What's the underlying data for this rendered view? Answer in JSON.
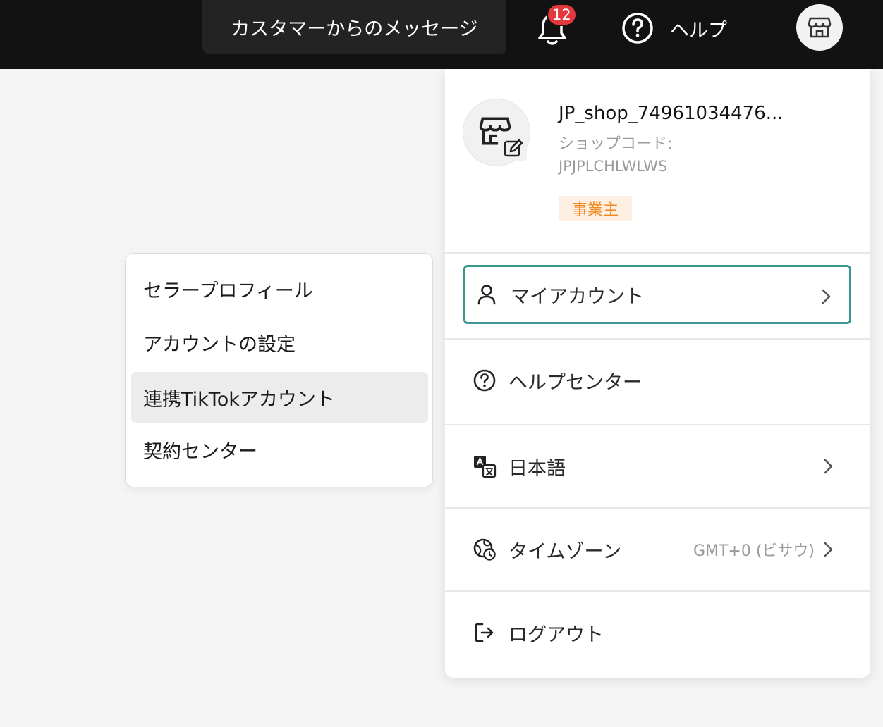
{
  "header": {
    "customer_messages_label": "カスタマーからのメッセージ",
    "notification_count": "12",
    "help_label": "ヘルプ"
  },
  "account_panel": {
    "shop_name": "JP_shop_74961034476...",
    "shop_code_label": "ショップコード:",
    "shop_code": "JPJPLCHLWLWS",
    "owner_badge": "事業主",
    "items": [
      {
        "label": "マイアカウント",
        "icon": "user-icon",
        "selected": true
      },
      {
        "label": "ヘルプセンター",
        "icon": "question-circle-icon"
      },
      {
        "label": "日本語",
        "icon": "translate-icon"
      },
      {
        "label": "タイムゾーン",
        "icon": "globe-clock-icon",
        "value": "GMT+0 (ビサウ)"
      },
      {
        "label": "ログアウト",
        "icon": "logout-icon"
      }
    ]
  },
  "submenu": {
    "items": [
      {
        "label": "セラープロフィール"
      },
      {
        "label": "アカウントの設定"
      },
      {
        "label": "連携TikTokアカウント",
        "active": true
      },
      {
        "label": "契約センター"
      }
    ]
  },
  "colors": {
    "topbar": "#121212",
    "badge_red": "#e4393c",
    "selected_border": "#3a968f",
    "owner_badge_bg": "#fdf0e3",
    "owner_badge_text": "#f08a24"
  }
}
